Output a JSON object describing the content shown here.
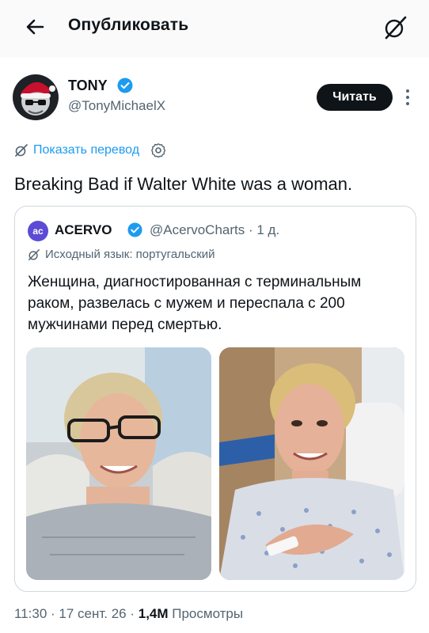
{
  "header": {
    "title": "Опубликовать"
  },
  "tweet": {
    "author_name": "TONY",
    "handle": "@TonyMichaelX",
    "follow_label": "Читать",
    "translate_label": "Показать перевод",
    "text": "Breaking Bad if Walter White was a woman."
  },
  "quote": {
    "avatar_text": "ac",
    "author_name": "ACERVO",
    "handle_time": "@AcervoCharts · 1 д.",
    "source_language": "Исходный язык: португальский",
    "text": "Женщина, диагностированная с терминальным раком, развелась с мужем и переспала с 200 мужчинами перед смертью."
  },
  "meta": {
    "time_date": "11:30 · 17 сент. 26 · ",
    "views_count": "1,4M",
    "views_label": " Просмотры"
  },
  "colors": {
    "accent": "#1d9bf0",
    "text": "#0f1419",
    "secondary": "#536471",
    "border": "#cfd9de"
  }
}
